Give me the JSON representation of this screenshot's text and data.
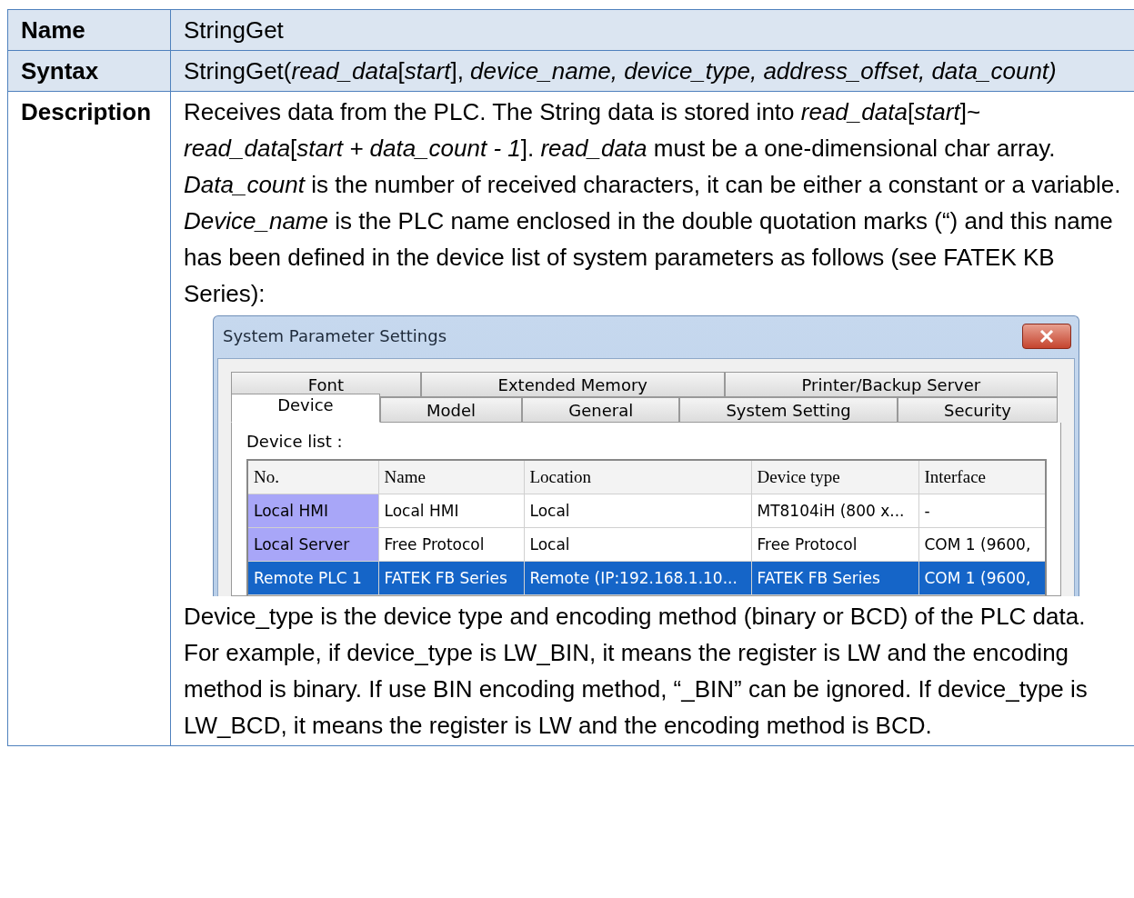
{
  "rows": [
    {
      "label": "Name",
      "kind": "header",
      "value": "StringGet"
    },
    {
      "label": "Syntax",
      "kind": "header",
      "value": "StringGet(*read_data*[*start*], *device_name, device_type, address_offset, data_count)*"
    },
    {
      "label": "Description",
      "kind": "body",
      "paragraphs_before": [
        "Receives data from the PLC. The String data is stored into *read_data*[*start*]~ *read_data*[*start + data_count - 1*]. *read_data* must be a one-dimensional char array.",
        "*Data_count* is the number of received characters, it can be either a constant or a variable.",
        "*Device_name* is the PLC name enclosed in the double quotation marks (“) and this name has been defined in the device list of system parameters as follows (see FATEK KB Series):"
      ],
      "dialog": {
        "title": "System Parameter Settings",
        "tab_rows": [
          [
            {
              "label": "Font",
              "selected": false
            },
            {
              "label": "Extended Memory",
              "selected": false
            },
            {
              "label": "Printer/Backup Server",
              "selected": false
            }
          ],
          [
            {
              "label": "Device",
              "selected": true
            },
            {
              "label": "Model",
              "selected": false
            },
            {
              "label": "General",
              "selected": false
            },
            {
              "label": "System Setting",
              "selected": false
            },
            {
              "label": "Security",
              "selected": false
            }
          ]
        ],
        "list_label": "Device list :",
        "columns": [
          "No.",
          "Name",
          "Location",
          "Device type",
          "Interface"
        ],
        "devices": [
          {
            "cells": [
              "Local HMI",
              "Local HMI",
              "Local",
              "MT8104iH (800 x...",
              "-"
            ],
            "selected": false
          },
          {
            "cells": [
              "Local Server",
              "Free Protocol",
              "Local",
              "Free Protocol",
              "COM 1 (9600,"
            ],
            "selected": false
          },
          {
            "cells": [
              "Remote PLC 1",
              "FATEK FB Series",
              "Remote (IP:192.168.1.10...",
              "FATEK FB Series",
              "COM 1 (9600,"
            ],
            "selected": true
          }
        ]
      },
      "paragraphs_after": [
        "Device_type is the device type and encoding method (binary or BCD) of the PLC data. For example, if device_type is LW_BIN, it means the register is LW and the encoding method is binary. If use BIN encoding method, “_BIN” can be ignored. If device_type is LW_BCD, it means the register is LW and the encoding method is BCD."
      ]
    }
  ]
}
